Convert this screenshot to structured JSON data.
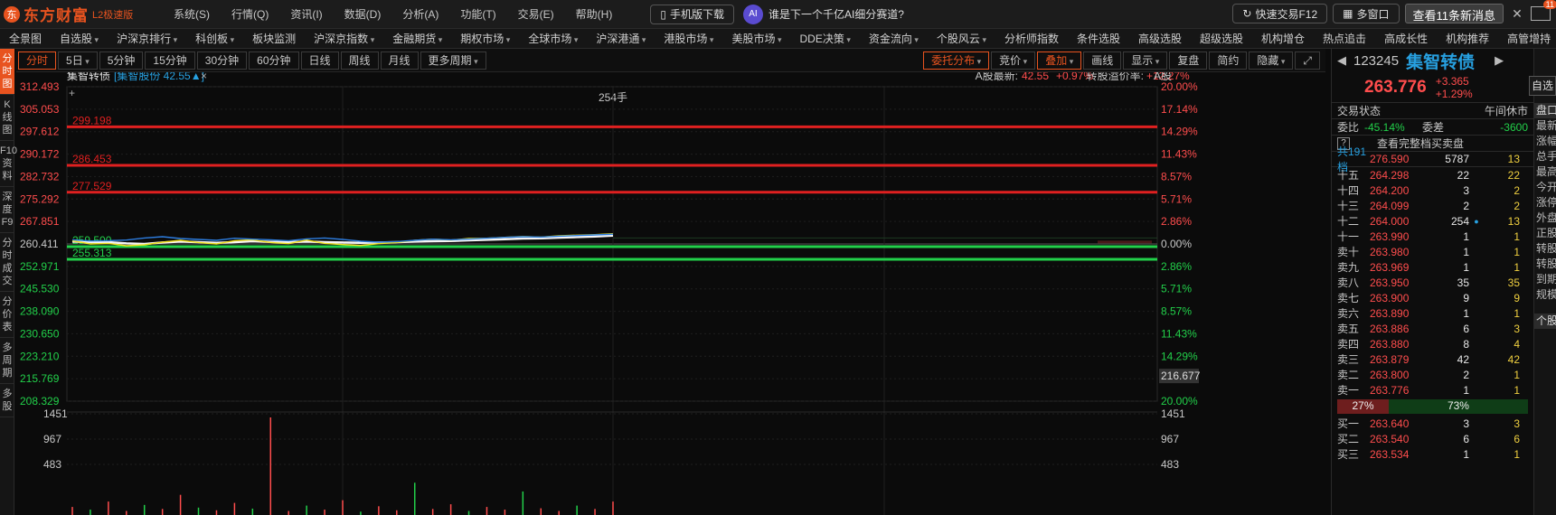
{
  "title_bar": {
    "logo_text": "东方财富",
    "edition": "L2极速版",
    "menus": [
      "系统(S)",
      "行情(Q)",
      "资讯(I)",
      "数据(D)",
      "分析(A)",
      "功能(T)",
      "交易(E)",
      "帮助(H)"
    ],
    "mobile_label": "手机版下载",
    "promo_text": "谁是下一个千亿AI细分赛道?",
    "quick_trade": "快速交易F12",
    "multi_window": "多窗口",
    "news_label": "查看11条新消息",
    "mail_badge": "11"
  },
  "nav": {
    "items": [
      "全景图",
      "自选股",
      "沪深京排行",
      "科创板",
      "板块监测",
      "沪深京指数",
      "金融期货",
      "期权市场",
      "全球市场",
      "沪深港通",
      "港股市场",
      "美股市场",
      "DDE决策",
      "资金流向",
      "个股风云",
      "分析师指数",
      "条件选股",
      "高级选股",
      "超级选股",
      "机构增仓",
      "热点追击",
      "高成长性",
      "机构推荐",
      "高管增持"
    ],
    "caret_flags": [
      false,
      true,
      true,
      true,
      false,
      true,
      true,
      true,
      true,
      true,
      true,
      true,
      true,
      true,
      true,
      false,
      false,
      false,
      false,
      false,
      false,
      false,
      false,
      false
    ]
  },
  "left_tabs": [
    "分时图",
    "K线图",
    "F10资料",
    "深度F9",
    "分时成交",
    "分价表",
    "多周期",
    "多股"
  ],
  "chart_toolbar": {
    "left_buttons": [
      "分时",
      "5日",
      "5分钟",
      "15分钟",
      "30分钟",
      "60分钟",
      "日线",
      "周线",
      "月线",
      "更多周期"
    ],
    "left_caret": [
      false,
      true,
      false,
      false,
      false,
      false,
      false,
      false,
      false,
      true
    ],
    "right_buttons": [
      "委托分布",
      "竞价",
      "叠加",
      "画线",
      "显示",
      "复盘",
      "简约",
      "隐藏"
    ],
    "right_caret": [
      true,
      true,
      true,
      false,
      true,
      false,
      false,
      true
    ],
    "right_active": [
      true,
      false,
      true,
      false,
      false,
      false,
      false,
      false
    ],
    "fullscreen_icon": "expand-icon"
  },
  "chart_header": {
    "name": "集智转债",
    "overlay": "[集智股份 42.55▲]",
    "close_glyph": "×",
    "a_share_label": "A股最新:",
    "a_share_price": "42.55",
    "a_share_pct": "+0.97%",
    "premium_label": "转股溢价率:",
    "premium_value": "+12.27%",
    "a_share_tag": "A股",
    "cursor_label": "254手",
    "plus_glyph": "+"
  },
  "chart_data": {
    "type": "line",
    "title": "集智转债",
    "y_axis_left": [
      "312.493",
      "305.053",
      "297.612",
      "290.172",
      "282.732",
      "275.292",
      "267.851",
      "260.411",
      "252.971",
      "245.530",
      "238.090",
      "230.650",
      "223.210",
      "215.769",
      "208.329"
    ],
    "y_axis_right": [
      "20.00%",
      "17.14%",
      "14.29%",
      "11.43%",
      "8.57%",
      "5.71%",
      "2.86%",
      "0.00%",
      "2.86%",
      "5.71%",
      "8.57%",
      "11.43%",
      "14.29%",
      "17.14%",
      "20.00%"
    ],
    "ylim": [
      208.329,
      312.493
    ],
    "prev_close": 260.411,
    "resistance_lines": [
      {
        "value": 299.198,
        "label": "299.198",
        "color": "#e02020"
      },
      {
        "value": 286.453,
        "label": "286.453",
        "color": "#e02020"
      },
      {
        "value": 277.529,
        "label": "277.529",
        "color": "#e02020"
      }
    ],
    "support_lines": [
      {
        "value": 259.5,
        "label": "259.500",
        "color": "#22d04a"
      },
      {
        "value": 255.313,
        "label": "255.313",
        "color": "#22d04a"
      }
    ],
    "crosshair_value": "216.677",
    "volume_axis": [
      "1451",
      "967",
      "483"
    ],
    "series": [
      {
        "color": "#f5f5f5",
        "values": [
          261.2,
          261.0,
          261.0,
          260.6,
          260.4,
          260.9,
          261.2,
          261.0,
          260.8,
          261.0,
          261.3,
          261.1,
          261.0,
          261.2,
          261.0,
          260.9,
          260.8,
          260.9,
          261.0,
          261.2,
          261.3,
          261.4,
          261.6,
          261.8,
          262.0,
          262.2,
          262.3,
          262.5,
          262.7,
          262.9,
          263.2
        ]
      },
      {
        "color": "#f0e020",
        "values": [
          261.5,
          260.4,
          260.6,
          259.8,
          260.1,
          261.0,
          261.6,
          260.9,
          260.4,
          261.5,
          261.8,
          260.9,
          260.5,
          261.7,
          260.6,
          260.2,
          259.9,
          260.5,
          260.9,
          261.6,
          262.0,
          261.7,
          262.2,
          262.3,
          262.6,
          262.9,
          262.7,
          263.1,
          263.3,
          263.5,
          263.8
        ]
      },
      {
        "color": "#2d7de0",
        "values": [
          261.8,
          261.4,
          261.5,
          261.7,
          262.4,
          262.8,
          262.2,
          261.9,
          261.6,
          262.3,
          262.0,
          261.8,
          261.5,
          262.1,
          262.4,
          261.9,
          261.3,
          261.0,
          261.2,
          261.6,
          262.0,
          261.8,
          262.0,
          262.3,
          262.6,
          262.8,
          262.7,
          263.0,
          263.2,
          263.4,
          263.6
        ]
      }
    ],
    "volume_values": [
      120,
      80,
      200,
      60,
      150,
      90,
      300,
      110,
      70,
      180,
      95,
      1451,
      60,
      140,
      80,
      220,
      50,
      130,
      70,
      480,
      90,
      160,
      60,
      120,
      80,
      350,
      100,
      60,
      140,
      90,
      200
    ]
  },
  "quote_panel": {
    "code": "123245",
    "name": "集智转债",
    "price": "263.776",
    "change": "+3.365",
    "change_pct": "+1.29%",
    "trade_state_label": "交易状态",
    "trade_state": "午间休市",
    "ratio_label": "委比",
    "ratio_value": "-45.14%",
    "diff_label": "委差",
    "diff_value": "-3600",
    "full_book": "查看完整档买卖盘",
    "total_level_label": "共191档",
    "total_level_price": "276.590",
    "total_level_vol": "5787",
    "total_level_tv": "13",
    "asks": [
      {
        "label": "十五",
        "price": "264.298",
        "vol": "22",
        "mark": "",
        "tv": "22"
      },
      {
        "label": "十四",
        "price": "264.200",
        "vol": "3",
        "mark": "",
        "tv": "2"
      },
      {
        "label": "十三",
        "price": "264.099",
        "vol": "2",
        "mark": "",
        "tv": "2"
      },
      {
        "label": "十二",
        "price": "264.000",
        "vol": "254",
        "mark": "●",
        "tv": "13"
      },
      {
        "label": "十一",
        "price": "263.990",
        "vol": "1",
        "mark": "",
        "tv": "1"
      },
      {
        "label": "卖十",
        "price": "263.980",
        "vol": "1",
        "mark": "",
        "tv": "1"
      },
      {
        "label": "卖九",
        "price": "263.969",
        "vol": "1",
        "mark": "",
        "tv": "1"
      },
      {
        "label": "卖八",
        "price": "263.950",
        "vol": "35",
        "mark": "",
        "tv": "35"
      },
      {
        "label": "卖七",
        "price": "263.900",
        "vol": "9",
        "mark": "",
        "tv": "9"
      },
      {
        "label": "卖六",
        "price": "263.890",
        "vol": "1",
        "mark": "",
        "tv": "1"
      },
      {
        "label": "卖五",
        "price": "263.886",
        "vol": "6",
        "mark": "",
        "tv": "3"
      },
      {
        "label": "卖四",
        "price": "263.880",
        "vol": "8",
        "mark": "",
        "tv": "4"
      },
      {
        "label": "卖三",
        "price": "263.879",
        "vol": "42",
        "mark": "",
        "tv": "42"
      },
      {
        "label": "卖二",
        "price": "263.800",
        "vol": "2",
        "mark": "",
        "tv": "1"
      },
      {
        "label": "卖一",
        "price": "263.776",
        "vol": "1",
        "mark": "",
        "tv": "1"
      }
    ],
    "sell_ratio": "27%",
    "buy_ratio": "73%",
    "bids": [
      {
        "label": "买一",
        "price": "263.640",
        "vol": "3",
        "mark": "",
        "tv": "3"
      },
      {
        "label": "买二",
        "price": "263.540",
        "vol": "6",
        "mark": "",
        "tv": "6"
      },
      {
        "label": "买三",
        "price": "263.534",
        "vol": "1",
        "mark": "",
        "tv": "1"
      }
    ]
  },
  "far_panel": {
    "top_tab": "自选",
    "header": "盘口",
    "items": [
      "最新",
      "涨幅",
      "总手",
      "最高",
      "今开",
      "涨停",
      "外盘",
      "正股",
      "转股",
      "转股",
      "到期",
      "规模"
    ],
    "bottom_header": "个股"
  },
  "colors": {
    "brand": "#e8531f",
    "up": "#ff4d4d",
    "down": "#22d04a",
    "accent_blue": "#27a0e0",
    "yellow": "#f0d040"
  }
}
